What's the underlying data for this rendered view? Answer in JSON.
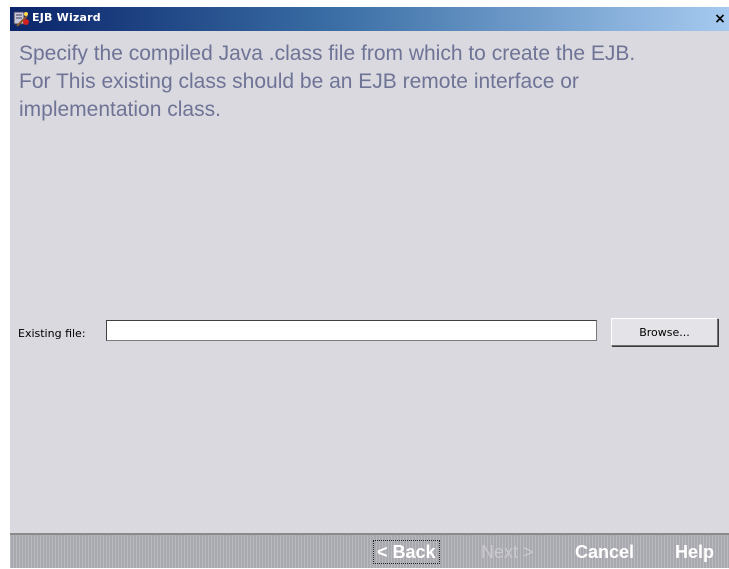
{
  "window": {
    "title": "EJB Wizard",
    "close_label": "×",
    "icon": "wizard-wand-icon"
  },
  "instructions": {
    "line1": "Specify the compiled Java .class file from which to create the EJB.",
    "line2": "For This existing class should be an EJB remote interface or",
    "line3": "implementation class."
  },
  "file_field": {
    "label": "Existing file:",
    "value": "",
    "browse_label": "Browse..."
  },
  "footer": {
    "back_label": "< Back",
    "next_label": "Next >",
    "next_enabled": false,
    "cancel_label": "Cancel",
    "help_label": "Help"
  },
  "colors": {
    "title_bar_start": "#0a246a",
    "title_bar_end": "#a6caf0",
    "instruction_text": "#6f7496",
    "panel_background": "#d9d9df"
  }
}
